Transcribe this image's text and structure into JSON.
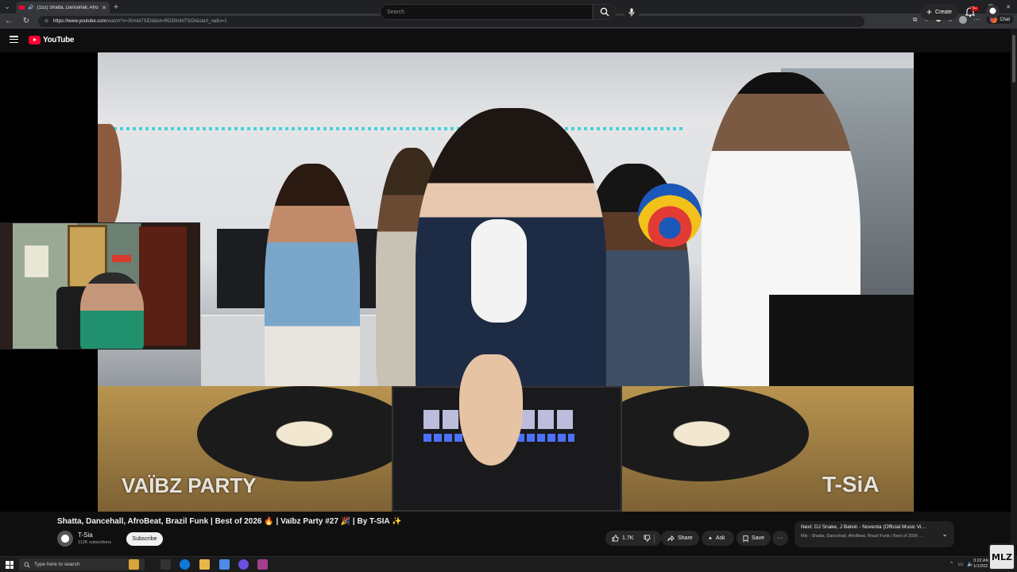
{
  "browser": {
    "tab_title": "(152) Shatta, Dancehall, Afro",
    "url_host": "https://www.youtube.com",
    "url_path": "/watch?v=30mbl7SiDI&list=RD30mbl7SiDI&start_radio=1",
    "chat_label": "Chat"
  },
  "youtube": {
    "logo_text": "YouTube",
    "search_placeholder": "Search",
    "create_label": "Create",
    "notification_count": "9+"
  },
  "video": {
    "watermark_left": "VAÏBZ PARTY",
    "watermark_right": "T-SiA",
    "title": "Shatta, Dancehall, AfroBeat, Brazil Funk | Best of 2026 🔥 | Vaïbz Party #27 🎉 | By T-SIA ✨",
    "channel_name": "T-Sia",
    "subscribers": "112K subscribers",
    "subscribe_label": "Subscribe",
    "like_count": "1.7K",
    "share_label": "Share",
    "ask_label": "Ask",
    "save_label": "Save",
    "more_label": "···"
  },
  "next_up": {
    "title": "Next: DJ Snake, J Balvin - Noventa (Official Music Vi…",
    "subtitle": "Mix - Shatta, Dancehall, AfroBeat, Brazil Funk | Best of 2026 …"
  },
  "taskbar": {
    "search_placeholder": "Type here to search",
    "time": "3:22 AM",
    "date": "1/1/202"
  },
  "overlay": {
    "logo_text": "MLZ"
  },
  "colors": {
    "brand_red": "#ff0033",
    "background": "#0f0f0f",
    "pill": "#272727"
  }
}
